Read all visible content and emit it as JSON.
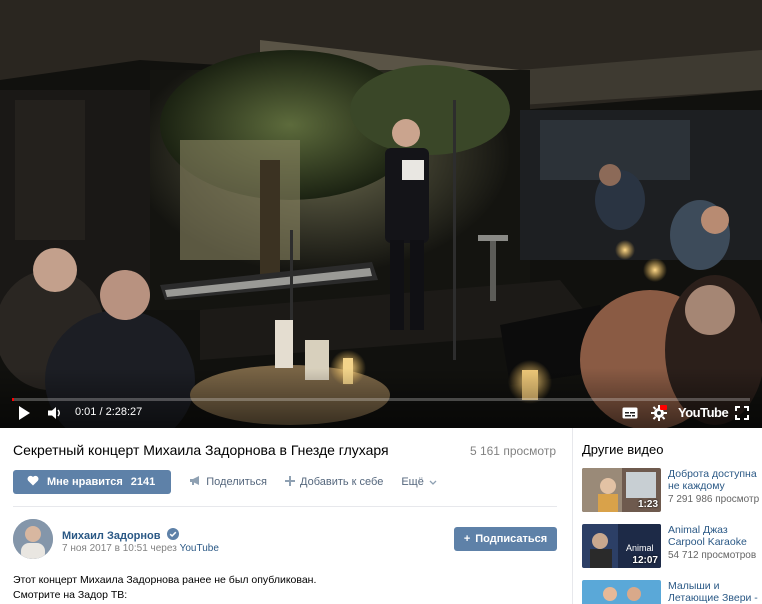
{
  "player": {
    "current_time": "0:01",
    "separator": " / ",
    "duration": "2:28:27",
    "youtube_label": "YouTube",
    "progress_fraction": 0.0001
  },
  "video": {
    "title": "Секретный концерт Михаила Задорнова в Гнезде глухаря",
    "views": "5 161 просмотр"
  },
  "actions": {
    "like_label": "Мне нравится",
    "like_count": "2141",
    "share_label": "Поделиться",
    "add_label": "Добавить к себе",
    "more_label": "Ещё"
  },
  "author": {
    "name": "Михаил Задорнов",
    "date": "7 ноя 2017 в 10:51 через",
    "source": "YouTube",
    "subscribe_label": "Подписаться"
  },
  "description": {
    "line1": "Этот концерт Михаила Задорнова ранее не был опубликован.",
    "line2": "Смотрите на Задор ТВ:"
  },
  "sidebar": {
    "title": "Другие видео",
    "items": [
      {
        "title_1": "Доброта доступна",
        "title_2": "не каждому",
        "views": "7 291 986 просмотр",
        "duration": "1:23"
      },
      {
        "title_1": "Animal Джаз",
        "title_2": "Carpool Karaoke",
        "views": "54 712 просмотров",
        "duration": "12:07"
      },
      {
        "title_1": "Малыши и",
        "title_2": "Летающие Звери -",
        "views": "",
        "duration": ""
      }
    ]
  },
  "colors": {
    "accent": "#5e81a8",
    "link": "#2a5885",
    "muted": "#828282",
    "progress": "#ff0000"
  }
}
